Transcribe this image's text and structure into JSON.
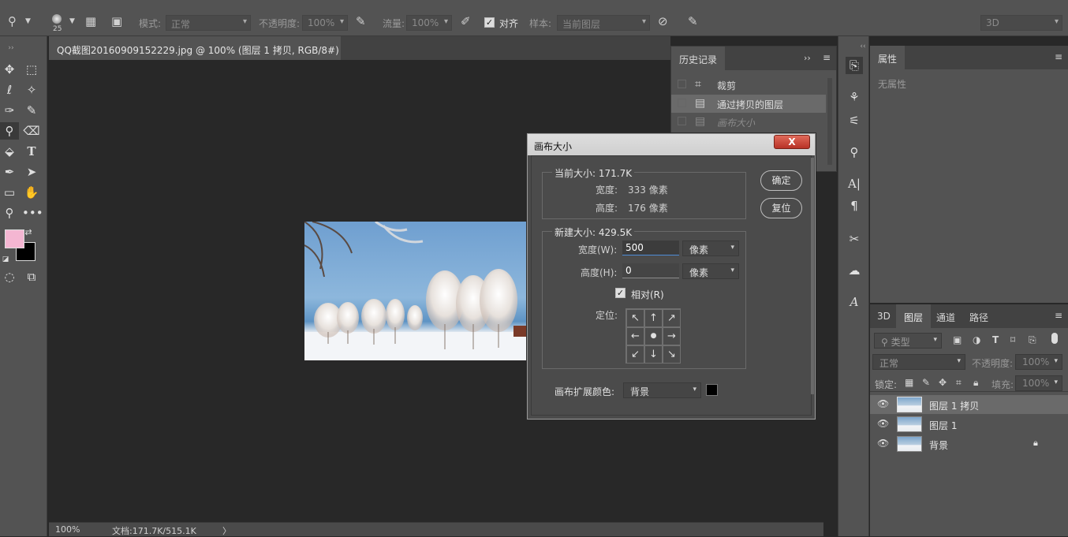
{
  "options_bar": {
    "brush_size": "25",
    "mode_label": "模式:",
    "mode_value": "正常",
    "opacity_label": "不透明度:",
    "opacity_value": "100%",
    "flow_label": "流量:",
    "flow_value": "100%",
    "align_label": "对齐",
    "sample_label": "样本:",
    "sample_value": "当前图层",
    "workspace": "3D"
  },
  "document_tab": {
    "title": "QQ截图20160909152229.jpg @ 100% (图层 1 拷贝, RGB/8#) *",
    "close": "×"
  },
  "status_bar": {
    "zoom": "100%",
    "doc_info": "文档:171.7K/515.1K",
    "arrow": "〉"
  },
  "history_panel": {
    "tab": "历史记录",
    "menu_glyph": "≡",
    "expand_glyph": "››",
    "items": [
      {
        "label": "裁剪",
        "icon": "crop-icon"
      },
      {
        "label": "通过拷贝的图层",
        "icon": "document-icon"
      },
      {
        "label": "画布大小",
        "icon": "document-icon"
      }
    ]
  },
  "properties_panel": {
    "tab": "属性",
    "empty_text": "无属性",
    "menu_glyph": "≡"
  },
  "layers_panel": {
    "tabs": [
      "3D",
      "图层",
      "通道",
      "路径"
    ],
    "active_tab": "图层",
    "filter_label": "类型",
    "blend_mode": "正常",
    "opacity_label": "不透明度:",
    "opacity_value": "100%",
    "lock_label": "锁定:",
    "fill_label": "填充:",
    "fill_value": "100%",
    "layers": [
      {
        "name": "图层 1 拷贝",
        "selected": true,
        "locked": false
      },
      {
        "name": "图层 1",
        "selected": false,
        "locked": false
      },
      {
        "name": "背景",
        "selected": false,
        "locked": true
      }
    ]
  },
  "canvas_size_dialog": {
    "title": "画布大小",
    "close_glyph": "X",
    "current_size_label": "当前大小: 171.7K",
    "width_label": "宽度:",
    "width_value": "333 像素",
    "height_label": "高度:",
    "height_value": "176 像素",
    "new_size_label": "新建大小: 429.5K",
    "new_width_label": "宽度(W):",
    "new_width_value": "500",
    "new_width_unit": "像素",
    "new_height_label": "高度(H):",
    "new_height_value": "0",
    "new_height_unit": "像素",
    "relative_label": "相对(R)",
    "relative_checked": true,
    "anchor_label": "定位:",
    "anchor_glyphs": [
      "↖",
      "↑",
      "↗",
      "←",
      "●",
      "→",
      "↙",
      "↓",
      "↘"
    ],
    "ext_color_label": "画布扩展颜色:",
    "ext_color_value": "背景",
    "ext_color_swatch": "#000000",
    "ok_button": "确定",
    "reset_button": "复位"
  },
  "colors": {
    "foreground": "#f4b6d2",
    "background": "#000000"
  }
}
